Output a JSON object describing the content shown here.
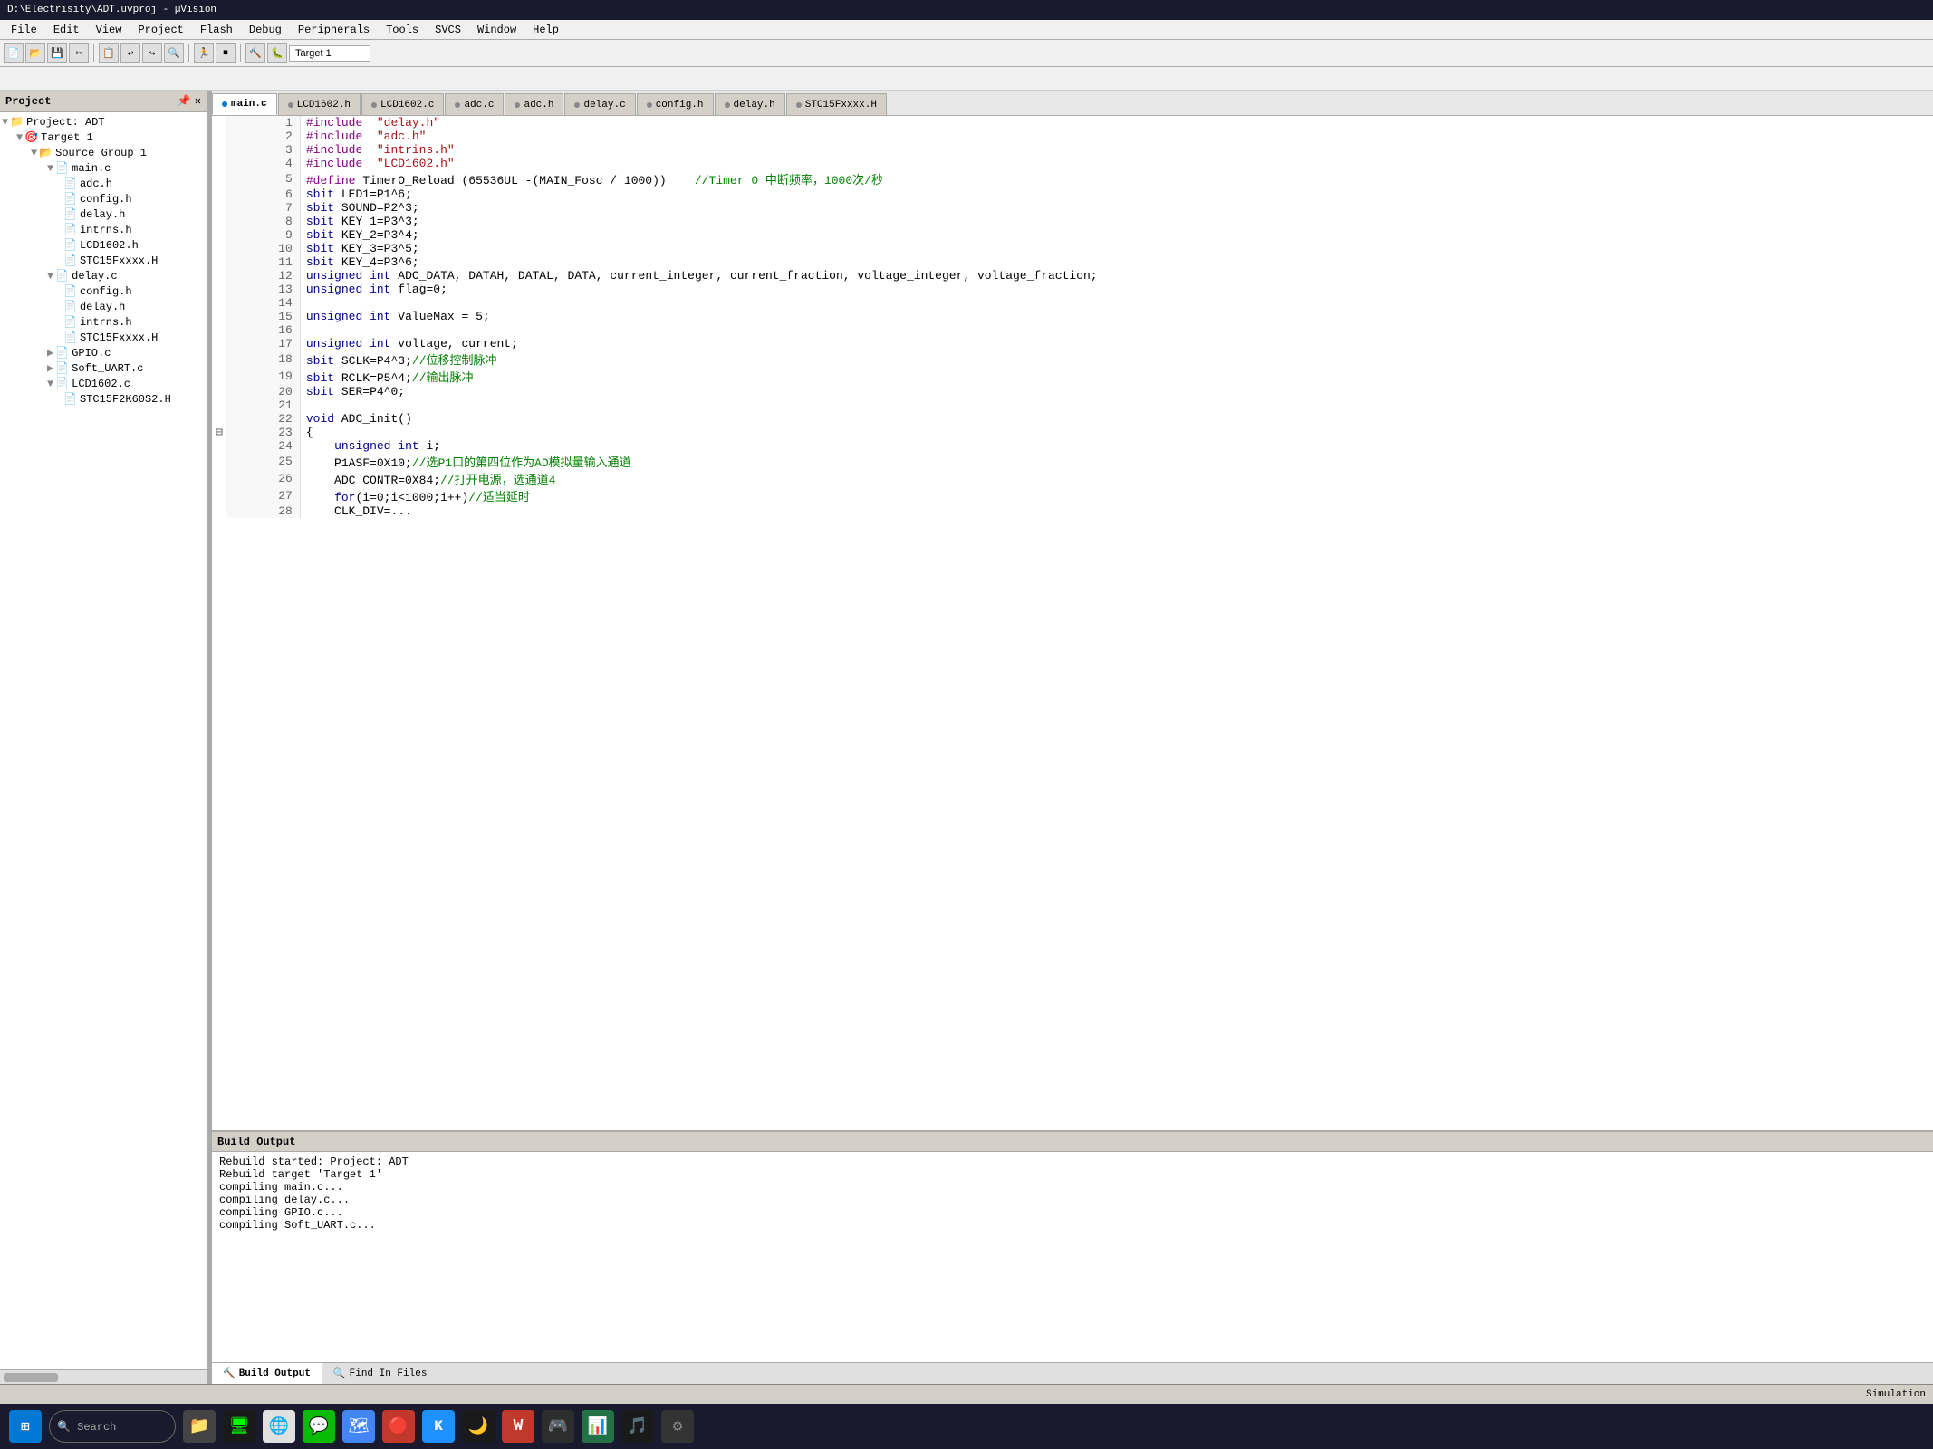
{
  "title_bar": {
    "text": "D:\\Electrisity\\ADT.uvproj - µVision"
  },
  "menu": {
    "items": [
      "File",
      "Edit",
      "View",
      "Project",
      "Flash",
      "Debug",
      "Peripherals",
      "Tools",
      "SVCS",
      "Window",
      "Help"
    ]
  },
  "toolbar": {
    "target_label": "Target 1"
  },
  "project": {
    "header": "Project",
    "root": "Project: ADT",
    "target": "Target 1",
    "source_group": "Source Group 1",
    "files": [
      {
        "name": "main.c",
        "indent": 4
      },
      {
        "name": "adc.h",
        "indent": 5
      },
      {
        "name": "config.h",
        "indent": 5
      },
      {
        "name": "delay.h",
        "indent": 5
      },
      {
        "name": "intrns.h",
        "indent": 5
      },
      {
        "name": "LCD1602.h",
        "indent": 5
      },
      {
        "name": "STC15Fxxxx.H",
        "indent": 5
      }
    ],
    "groups": [
      {
        "name": "delay.c",
        "indent": 3,
        "files": [
          {
            "name": "config.h",
            "indent": 5
          },
          {
            "name": "delay.h",
            "indent": 5
          },
          {
            "name": "intrns.h",
            "indent": 5
          },
          {
            "name": "STC15Fxxxx.H",
            "indent": 5
          }
        ]
      },
      {
        "name": "GPIO.c",
        "indent": 3
      },
      {
        "name": "Soft_UART.c",
        "indent": 3
      },
      {
        "name": "LCD1602.c",
        "indent": 3,
        "files": [
          {
            "name": "STC15F2K60S2.H",
            "indent": 5
          }
        ]
      }
    ]
  },
  "tabs": [
    {
      "label": "main.c",
      "active": true,
      "color": "#007acc"
    },
    {
      "label": "LCD1602.h",
      "active": false,
      "color": "#888"
    },
    {
      "label": "LCD1602.c",
      "active": false,
      "color": "#888"
    },
    {
      "label": "adc.c",
      "active": false,
      "color": "#888"
    },
    {
      "label": "adc.h",
      "active": false,
      "color": "#888"
    },
    {
      "label": "delay.c",
      "active": false,
      "color": "#888"
    },
    {
      "label": "config.h",
      "active": false,
      "color": "#888"
    },
    {
      "label": "delay.h",
      "active": false,
      "color": "#888"
    },
    {
      "label": "STC15Fxxxx.H",
      "active": false,
      "color": "#888"
    }
  ],
  "code": {
    "lines": [
      {
        "num": 1,
        "text": "#include  \"delay.h\"",
        "type": "pp"
      },
      {
        "num": 2,
        "text": "#include  \"adc.h\"",
        "type": "pp"
      },
      {
        "num": 3,
        "text": "#include  \"intrins.h\"",
        "type": "pp"
      },
      {
        "num": 4,
        "text": "#include  \"LCD1602.h\"",
        "type": "pp"
      },
      {
        "num": 5,
        "text": "#define TimerO_Reload (65536UL -(MAIN_Fosc / 1000))    //Timer 0 中断频率，1000次/秒",
        "type": "define"
      },
      {
        "num": 6,
        "text": "sbit LED1=P1^6;",
        "type": "code"
      },
      {
        "num": 7,
        "text": "sbit SOUND=P2^3;",
        "type": "code"
      },
      {
        "num": 8,
        "text": "sbit KEY_1=P3^3;",
        "type": "code"
      },
      {
        "num": 9,
        "text": "sbit KEY_2=P3^4;",
        "type": "code"
      },
      {
        "num": 10,
        "text": "sbit KEY_3=P3^5;",
        "type": "code"
      },
      {
        "num": 11,
        "text": "sbit KEY_4=P3^6;",
        "type": "code"
      },
      {
        "num": 12,
        "text": "unsigned int ADC_DATA, DATAH, DATAL, DATA, current_integer, current_fraction, voltage_integer, voltage_fraction;",
        "type": "code"
      },
      {
        "num": 13,
        "text": "unsigned int flag=0;",
        "type": "code"
      },
      {
        "num": 14,
        "text": "",
        "type": "empty"
      },
      {
        "num": 15,
        "text": "unsigned int ValueMax = 5;",
        "type": "code"
      },
      {
        "num": 16,
        "text": "",
        "type": "empty"
      },
      {
        "num": 17,
        "text": "unsigned int voltage, current;",
        "type": "code"
      },
      {
        "num": 18,
        "text": "sbit SCLK=P4^3;//位移控制脉冲",
        "type": "code_cm"
      },
      {
        "num": 19,
        "text": "sbit RCLK=P5^4;//输出脉冲",
        "type": "code_cm"
      },
      {
        "num": 20,
        "text": "sbit SER=P4^0;",
        "type": "code"
      },
      {
        "num": 21,
        "text": "",
        "type": "empty"
      },
      {
        "num": 22,
        "text": "void ADC_init()",
        "type": "fn"
      },
      {
        "num": 23,
        "text": "{",
        "type": "code",
        "collapse": true
      },
      {
        "num": 24,
        "text": "    unsigned int i;",
        "type": "code_in"
      },
      {
        "num": 25,
        "text": "    P1ASF=0X10;//选P1口的第四位作为AD模拟量输入通道",
        "type": "code_cm_in"
      },
      {
        "num": 26,
        "text": "    ADC_CONTR=0X84;//打开电源，选通道4",
        "type": "code_cm_in"
      },
      {
        "num": 27,
        "text": "    for(i=0;i<1000;i++)//适当延时",
        "type": "code_cm_in"
      },
      {
        "num": 28,
        "text": "    CLK_DIV=...",
        "type": "code_in"
      }
    ]
  },
  "build_output": {
    "lines": [
      "Rebuild started: Project: ADT",
      "Rebuild target 'Target 1'",
      "compiling main.c...",
      "compiling delay.c...",
      "compiling GPIO.c...",
      "compiling Soft_UART.c..."
    ]
  },
  "build_tabs": [
    {
      "label": "Build Output",
      "active": true,
      "icon": "🔨"
    },
    {
      "label": "Find In Files",
      "active": false,
      "icon": "🔍"
    }
  ],
  "status_bar": {
    "text": "Simulation"
  },
  "taskbar_icons": [
    "⊞",
    "📁",
    "🖥",
    "🌐",
    "🔴",
    "💬",
    "🌐",
    "🔧",
    "🎮",
    "📊",
    "🎵",
    "⚙"
  ]
}
